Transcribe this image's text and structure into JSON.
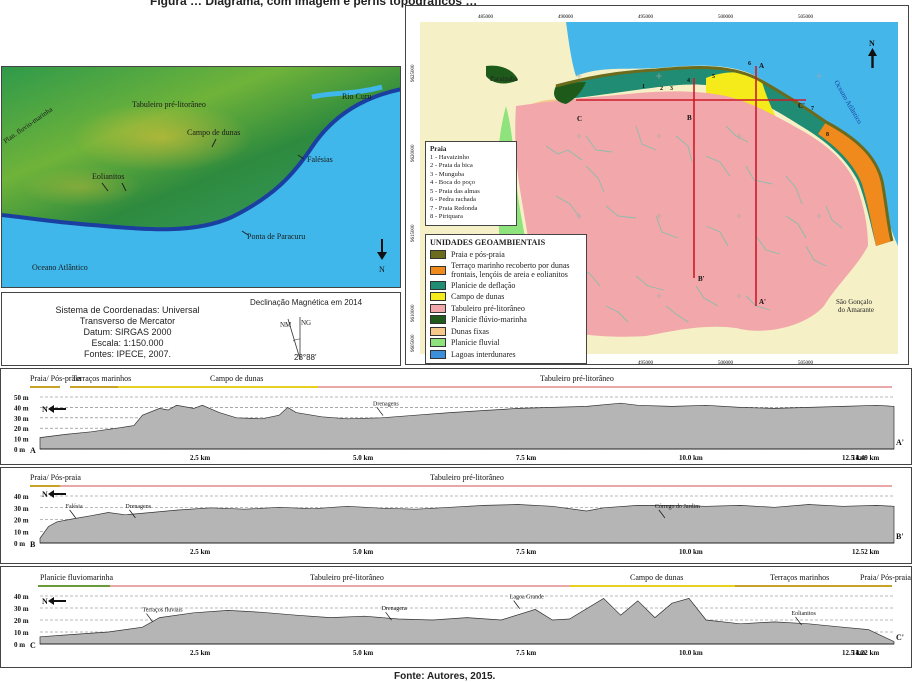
{
  "figure": {
    "title": "Figura … Diagrama, com imagem e perfis topográficos …",
    "source": "Fonte: Autores, 2015."
  },
  "relief_map": {
    "labels": [
      "Tabuleiro pré-litorâneo",
      "Rio Curu",
      "Campo de dunas",
      "Eolianitos",
      "Falésias",
      "Ponta de Paracuru",
      "Oceano Atlântico",
      "Plan. fluvio-marinha"
    ],
    "north": "N"
  },
  "info": {
    "coord_system": "Sistema de Coordenadas: Universal",
    "projection": "Transverso de Mercator",
    "datum": "Datum: SIRGAS 2000",
    "scale": "Escala: 1:150.000",
    "sources": "Fontes: IPECE, 2007.",
    "declination_title": "Declinação Magnética em 2014",
    "nm": "NM",
    "ng": "NG",
    "declination_value": "23°88'"
  },
  "geo_map": {
    "top_coords": [
      "485000",
      "490000",
      "495000",
      "500000",
      "505000"
    ],
    "bottom_coords": [
      "485000",
      "490000",
      "495000",
      "500000",
      "505000"
    ],
    "left_coords": [
      "9625000",
      "9620000",
      "9615000",
      "9610000",
      "9605000"
    ],
    "places": {
      "paraipaba": "Paraipaba",
      "sao_goncalo_1": "São Gonçalo",
      "sao_goncalo_2": "do Amarante",
      "ocean": "Oceano Atlântico",
      "north": "N"
    },
    "profile_letters": {
      "a": "A",
      "a2": "A'",
      "b": "B",
      "b2": "B'",
      "c": "C",
      "c2": "C'"
    },
    "beach_numbers": [
      "1",
      "2",
      "3",
      "4",
      "5",
      "6",
      "7",
      "8"
    ],
    "praia_title": "Praia",
    "praias": [
      "1 - Havaizinho",
      "2 - Praia da bica",
      "3 - Munguba",
      "4 - Boca do poço",
      "5 - Praia das almas",
      "6 - Pedra rachada",
      "7 - Praia Redonda",
      "8 - Piriquara"
    ],
    "units_title": "UNIDADES GEOAMBIENTAIS",
    "units": [
      {
        "label": "Praia e pós-praia",
        "color": "#6b6b1e"
      },
      {
        "label": "Terraço marinho recoberto por dunas frontais, lençóis de areia e eolianitos",
        "color": "#f08a1c"
      },
      {
        "label": "Planície de deflação",
        "color": "#1f8c73"
      },
      {
        "label": "Campo de dunas",
        "color": "#f5ea1a"
      },
      {
        "label": "Tabuleiro pré-litorâneo",
        "color": "#f2a7aa"
      },
      {
        "label": "Planície flúvio-marinha",
        "color": "#1e5b1a"
      },
      {
        "label": "Dunas fixas",
        "color": "#f5c98a"
      },
      {
        "label": "Planície fluvial",
        "color": "#8fe37c"
      },
      {
        "label": "Lagoas interdunares",
        "color": "#3a8fd8"
      }
    ]
  },
  "profiles": [
    {
      "id": "A",
      "start": "A",
      "end": "A'",
      "units": [
        {
          "label": "Praia/ Pós-praia",
          "color": "#c9a227"
        },
        {
          "label": "Terraços marinhos",
          "color": "#c9a227"
        },
        {
          "label": "Campo de dunas",
          "color": "#e6d21e"
        },
        {
          "label": "Tabuleiro pré-litorâneo",
          "color": "#e8a8a8"
        }
      ],
      "y_ticks": [
        "50 m",
        "40 m",
        "30 m",
        "20 m",
        "10 m",
        "0 m"
      ],
      "x_ticks": [
        "2.5 km",
        "5.0 km",
        "7.5 km",
        "10.0 km",
        "12.5 km"
      ],
      "x_end": "14.49 km",
      "annotations": [
        "Drenagens"
      ],
      "north": "N"
    },
    {
      "id": "B",
      "start": "B",
      "end": "B'",
      "units": [
        {
          "label": "Praia/ Pós-praia",
          "color": "#c9a227"
        },
        {
          "label": "Tabuleiro pré-litorâneo",
          "color": "#e8a8a8"
        }
      ],
      "y_ticks": [
        "40 m",
        "30 m",
        "20 m",
        "10 m",
        "0 m"
      ],
      "x_ticks": [
        "2.5 km",
        "5.0 km",
        "7.5 km",
        "10.0 km"
      ],
      "x_end": "12.52 km",
      "annotations": [
        "Falésia",
        "Drenagens",
        "Córrego do Jardim"
      ],
      "north": "N"
    },
    {
      "id": "C",
      "start": "C",
      "end": "C'",
      "units": [
        {
          "label": "Planície fluviomarinha",
          "color": "#6a9a3a"
        },
        {
          "label": "Tabuleiro pré-litorâneo",
          "color": "#e8a8a8"
        },
        {
          "label": "Campo de dunas",
          "color": "#e6d21e"
        },
        {
          "label": "Terraços marinhos",
          "color": "#c9a227"
        },
        {
          "label": "Praia/ Pós-praia",
          "color": "#c9a227"
        }
      ],
      "y_ticks": [
        "40 m",
        "30 m",
        "20 m",
        "10 m",
        "0 m"
      ],
      "x_ticks": [
        "2.5 km",
        "5.0 km",
        "7.5 km",
        "10.0 km",
        "12.5 km"
      ],
      "x_end": "14.22 km",
      "annotations": [
        "Terraços fluviais",
        "Drenagens",
        "Lagoa Grande",
        "Eolianitos"
      ],
      "north": "N"
    }
  ]
}
